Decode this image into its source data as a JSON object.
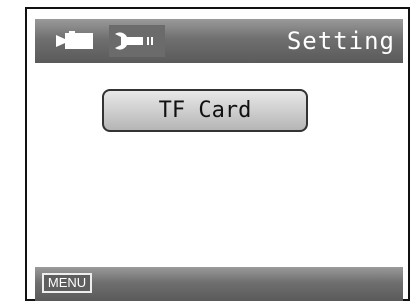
{
  "header": {
    "title": "Setting",
    "icons": [
      "camera-icon",
      "wrench-battery-icon"
    ]
  },
  "main": {
    "items": [
      {
        "label": "TF Card"
      }
    ]
  },
  "footer": {
    "menu_label": "MENU"
  },
  "colors": {
    "bar_gradient_top": "#9a9a9a",
    "bar_gradient_bottom": "#5a5a5a",
    "icon_selected_bg": "#6b6b6b",
    "button_gradient_top": "#e8e8e8",
    "button_gradient_bottom": "#b5b5b5",
    "text_light": "#ffffff",
    "text_dark": "#111111",
    "frame_border": "#111111"
  }
}
